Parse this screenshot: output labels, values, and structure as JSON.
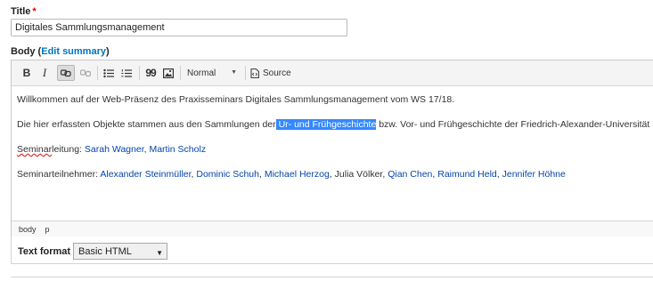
{
  "title_field": {
    "label": "Title",
    "required_marker": "*",
    "value": "Digitales Sammlungsmanagement"
  },
  "body_field": {
    "label": "Body (",
    "edit_summary": "Edit summary",
    "label_end": ")"
  },
  "toolbar": {
    "bold": "B",
    "italic": "I",
    "blockquote": "99",
    "format_value": "Normal",
    "source_label": "Source",
    "icons": [
      "link-icon",
      "unlink-icon",
      "bulleted-list-icon",
      "numbered-list-icon",
      "blockquote-icon",
      "image-icon",
      "chevron-down-icon",
      "source-icon"
    ]
  },
  "content": {
    "p1": "Willkommen auf der Web-Präsenz des Praxisseminars Digitales Sammlungsmanagement vom WS 17/18.",
    "p2_before": "Die hier erfassten Objekte stammen aus den Sammlungen der",
    "p2_selected": " Ur- und Frühgeschichte",
    "p2_after": " bzw. Vor- und Frühgeschichte der Friedrich-Alexander-Universität E",
    "p3_label_a": "Seminar",
    "p3_label_b": "leitung:",
    "p3_links": [
      "Sarah Wagner",
      "Martin Scholz"
    ],
    "p4_label": "Seminarteilnehmer:",
    "p4_names": [
      {
        "text": "Alexander Steinmüller",
        "link": true
      },
      {
        "text": "Dominic Schuh",
        "link": true
      },
      {
        "text": "Michael Herzog",
        "link": true
      },
      {
        "text": "Julia Völker",
        "link": false
      },
      {
        "text": "Qian Chen",
        "link": true
      },
      {
        "text": "Raimund Held",
        "link": true
      },
      {
        "text": "Jennifer Höhne",
        "link": true
      }
    ],
    "separator": ", "
  },
  "path": [
    "body",
    "p"
  ],
  "text_format": {
    "label": "Text format",
    "value": "Basic HTML"
  },
  "colors": {
    "link": "#0645ad",
    "selection": "#3388ff",
    "required": "#ee0000",
    "edit_summary": "#0074bd"
  }
}
